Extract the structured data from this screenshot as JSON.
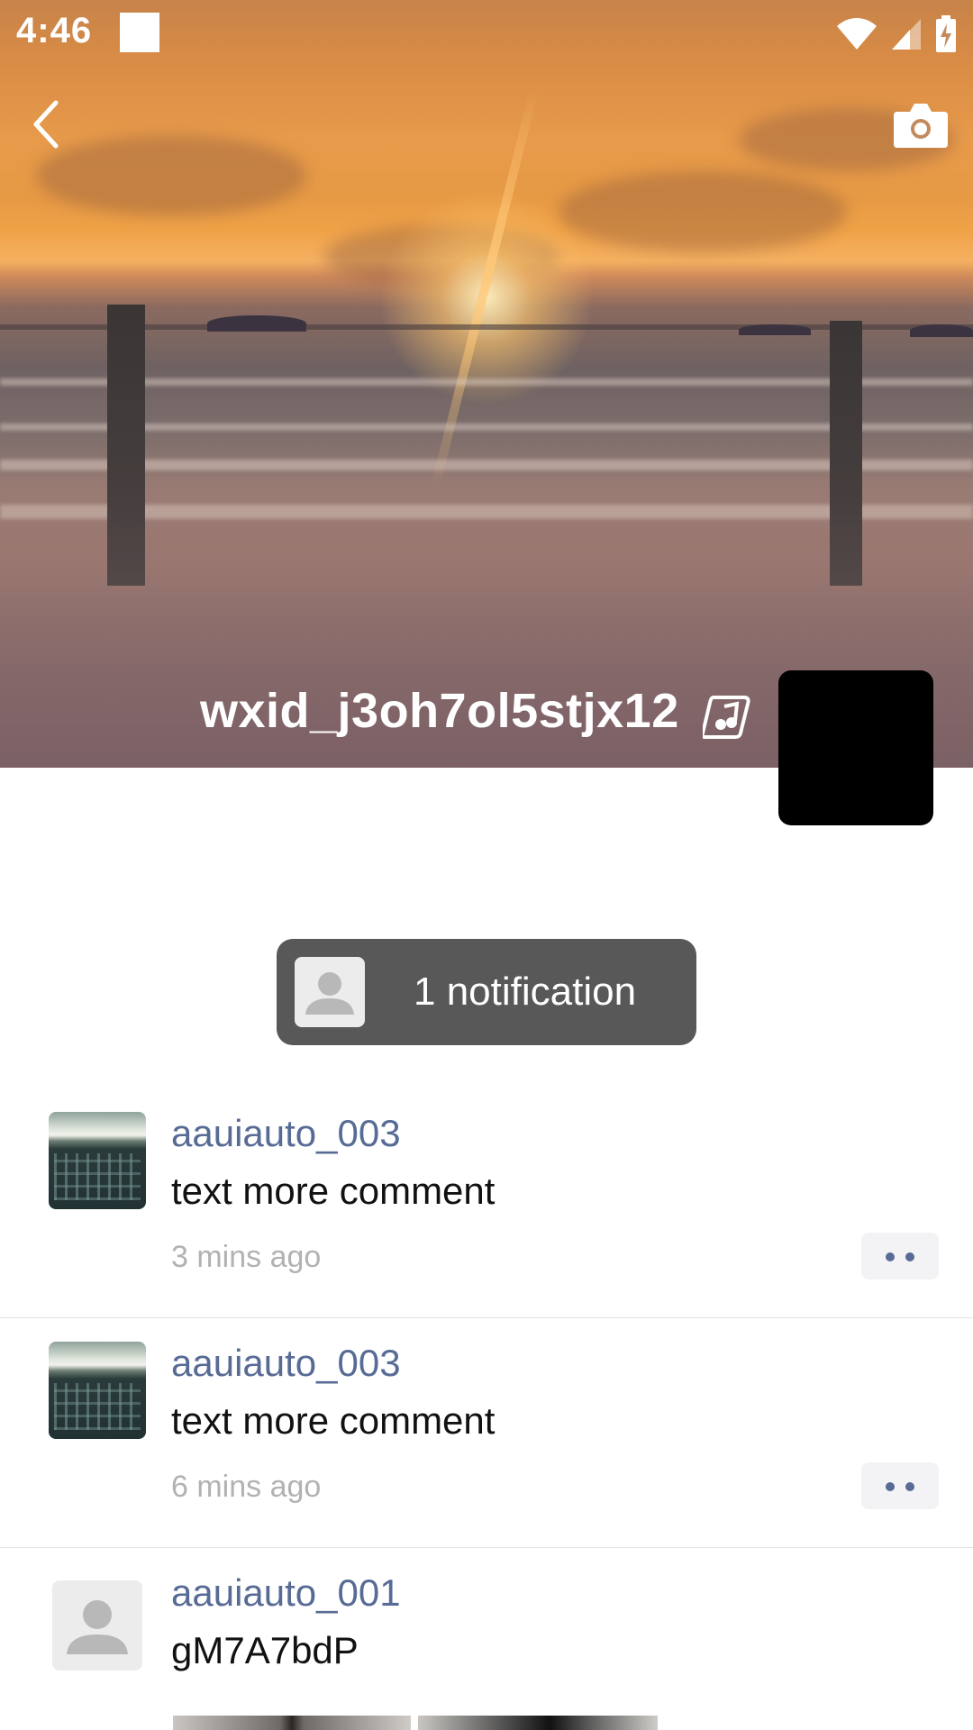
{
  "status_bar": {
    "time": "4:46",
    "icons": [
      "wifi-icon",
      "signal-icon",
      "battery-charging-icon"
    ]
  },
  "top_bar": {
    "back_icon": "chevron-left-icon",
    "camera_icon": "camera-icon"
  },
  "profile": {
    "username": "wxid_j3oh7ol5stjx12",
    "music_icon": "music-note-icon"
  },
  "notification": {
    "text": "1 notification"
  },
  "comments": [
    {
      "name": "aauiauto_003",
      "text": "text more comment",
      "time": "3 mins ago"
    },
    {
      "name": "aauiauto_003",
      "text": "text more comment",
      "time": "6 mins ago"
    },
    {
      "name": "aauiauto_001",
      "text": "gM7A7bdP",
      "time": ""
    }
  ],
  "colors": {
    "link": "#576b95",
    "notification_bg": "#585858",
    "timestamp": "#b2b2b2"
  }
}
